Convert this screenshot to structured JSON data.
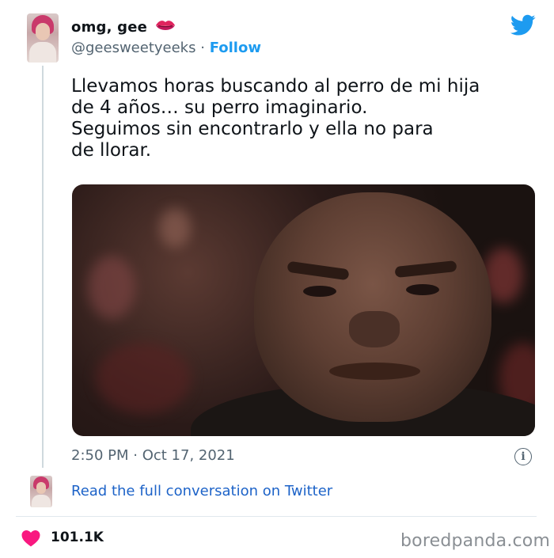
{
  "tweet": {
    "display_name": "omg, gee",
    "handle": "@geesweetyeeks",
    "separator": "·",
    "follow_label": "Follow",
    "text": "Llevamos horas buscando al perro de mi hija\nde 4 años… su perro imaginario.\nSeguimos sin encontrarlo y ella no para\nde llorar.",
    "timestamp": "2:50 PM · Oct 17, 2021",
    "read_conversation": "Read the full conversation on Twitter",
    "likes": "101.1K"
  },
  "icons": {
    "lips": "lips-emoji-icon",
    "bird": "twitter-bird-icon",
    "info": "info-icon",
    "heart": "heart-icon"
  },
  "colors": {
    "link_blue": "#1d9bf0",
    "heart_pink": "#f91880",
    "muted": "#536471",
    "text": "#0f1419"
  },
  "watermark": "boredpanda.com"
}
